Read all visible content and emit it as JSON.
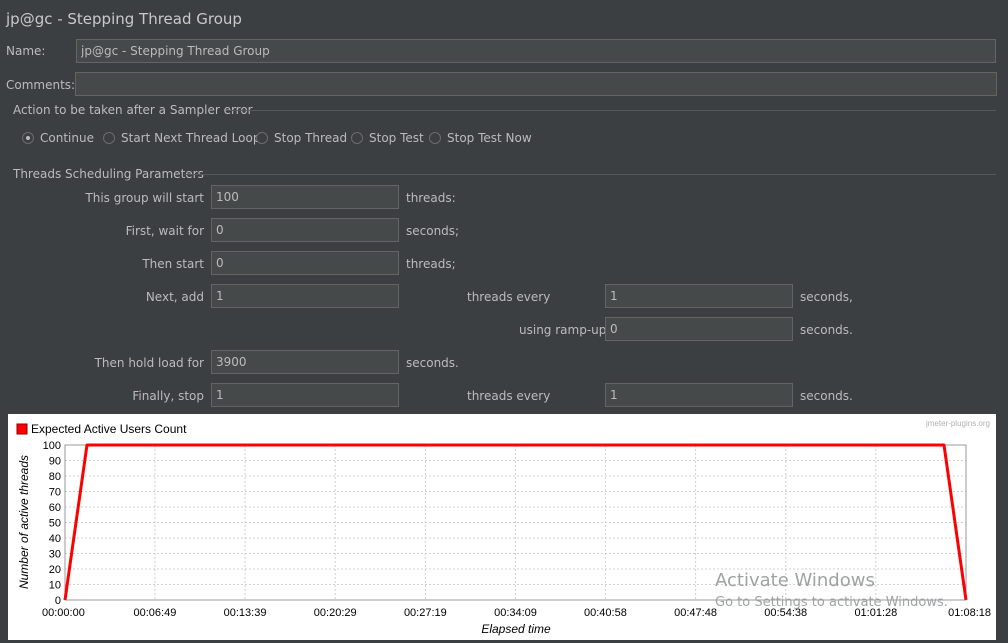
{
  "window": {
    "title": "jp@gc - Stepping Thread Group"
  },
  "name": {
    "label": "Name:",
    "value": "jp@gc - Stepping Thread Group"
  },
  "comments": {
    "label": "Comments:",
    "value": ""
  },
  "sampler_error": {
    "legend": "Action to be taken after a Sampler error",
    "options": [
      "Continue",
      "Start Next Thread Loop",
      "Stop Thread",
      "Stop Test",
      "Stop Test Now"
    ],
    "selected": "Continue"
  },
  "scheduling": {
    "legend": "Threads Scheduling Parameters",
    "start_label": "This group will start",
    "start_value": "100",
    "start_unit": "threads:",
    "wait_label": "First, wait for",
    "wait_value": "0",
    "wait_unit": "seconds;",
    "then_start_label": "Then start",
    "then_start_value": "0",
    "then_start_unit": "threads;",
    "next_add_label": "Next, add",
    "next_add_value": "1",
    "next_threads_every_label": "threads every",
    "next_threads_every_value": "1",
    "next_unit": "seconds,",
    "ramp_label": "using ramp-up",
    "ramp_value": "0",
    "ramp_unit": "seconds.",
    "hold_label": "Then hold load for",
    "hold_value": "3900",
    "hold_unit": "seconds.",
    "stop_label": "Finally, stop",
    "stop_value": "1",
    "stop_threads_every_label": "threads every",
    "stop_threads_every_value": "1",
    "stop_unit": "seconds."
  },
  "chart_data": {
    "type": "line",
    "legend": "Expected Active Users Count",
    "credit": "jmeter-plugins.org",
    "xlabel": "Elapsed time",
    "ylabel": "Number of active threads",
    "xlim": [
      0,
      4098
    ],
    "ylim": [
      0,
      100
    ],
    "x_ticks": [
      {
        "t": 0,
        "label": "00:00:00"
      },
      {
        "t": 409,
        "label": "00:06:49"
      },
      {
        "t": 819,
        "label": "00:13:39"
      },
      {
        "t": 1229,
        "label": "00:20:29"
      },
      {
        "t": 1639,
        "label": "00:27:19"
      },
      {
        "t": 2049,
        "label": "00:34:09"
      },
      {
        "t": 2458,
        "label": "00:40:58"
      },
      {
        "t": 2868,
        "label": "00:47:48"
      },
      {
        "t": 3278,
        "label": "00:54:38"
      },
      {
        "t": 3688,
        "label": "01:01:28"
      },
      {
        "t": 4098,
        "label": "01:08:18"
      }
    ],
    "y_ticks": [
      0,
      10,
      20,
      30,
      40,
      50,
      60,
      70,
      80,
      90,
      100
    ],
    "series": [
      {
        "color": "#ff0000",
        "points": [
          [
            0,
            0
          ],
          [
            100,
            100
          ],
          [
            3998,
            100
          ],
          [
            4098,
            0
          ]
        ]
      }
    ],
    "grid": true,
    "legend_position": "top-left"
  },
  "watermark": {
    "line1": "Activate Windows",
    "line2": "Go to Settings to activate Windows."
  }
}
